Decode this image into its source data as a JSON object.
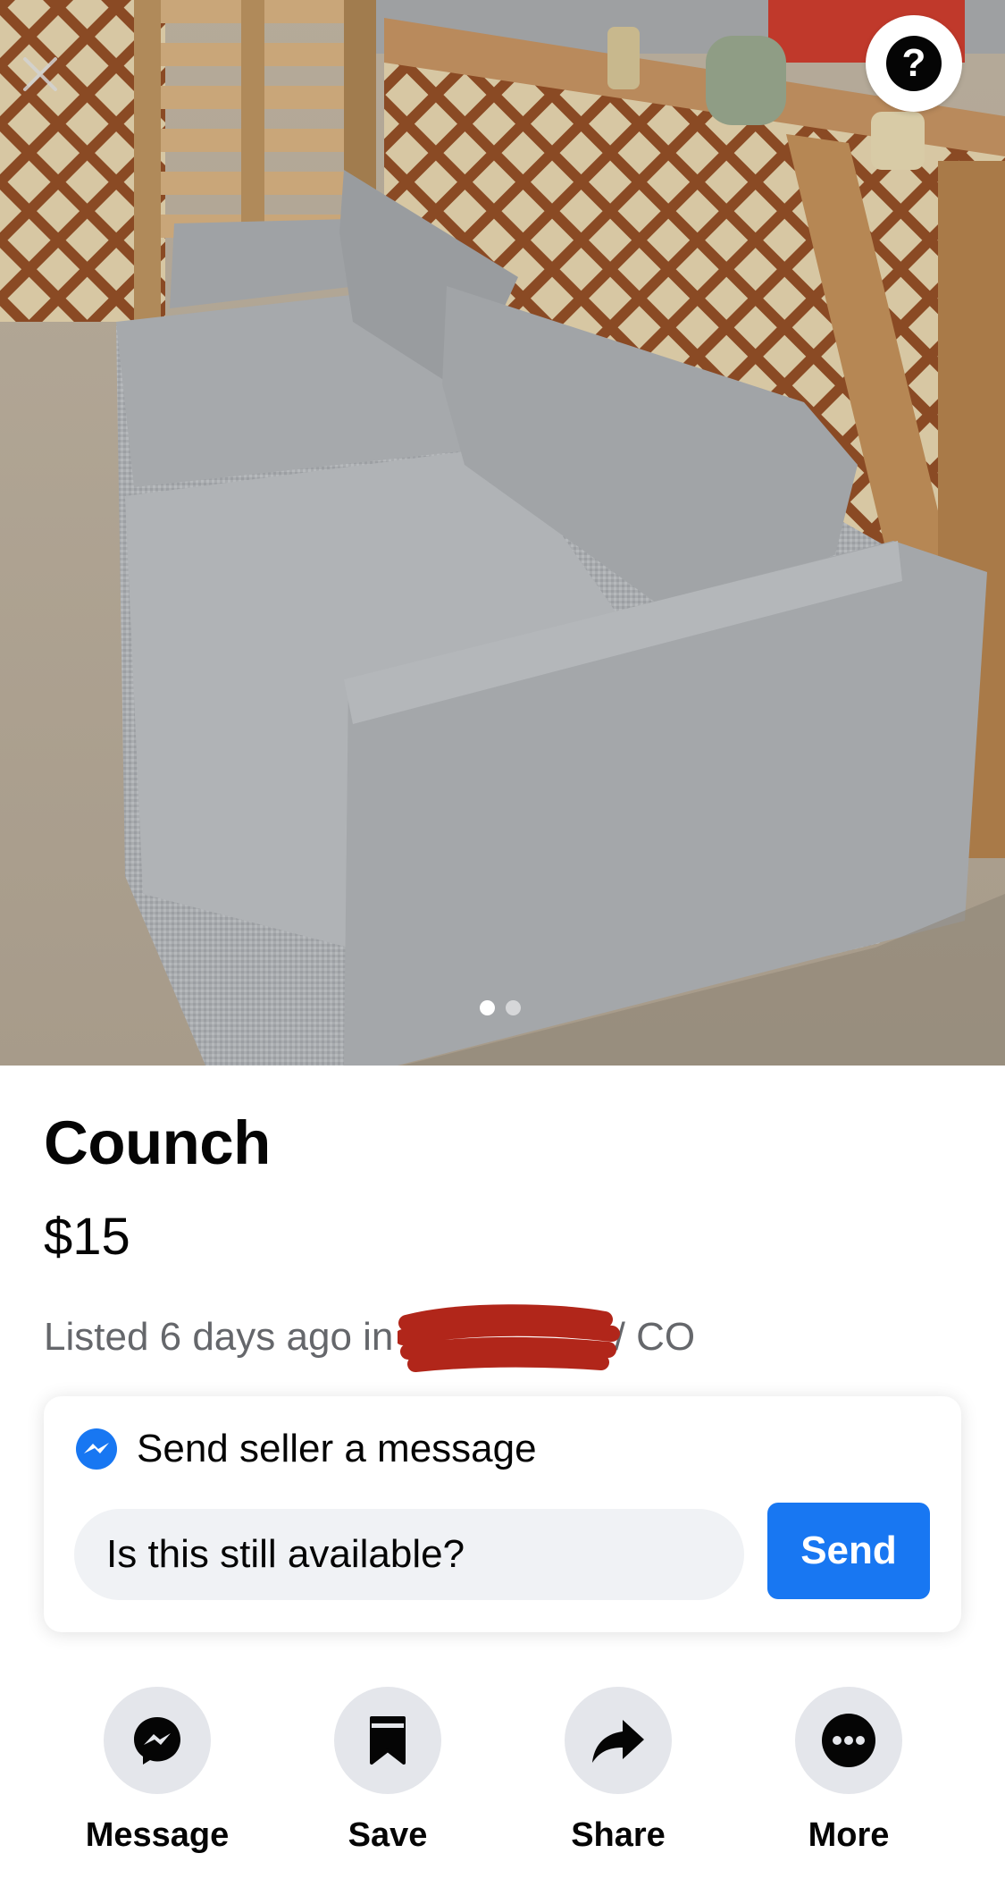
{
  "listing": {
    "title": "Counch",
    "price": "$15",
    "listed_prefix": "Listed 6 days ago in",
    "location_suffix": "/ CO"
  },
  "photo": {
    "image_count": 2,
    "active_index": 1,
    "close_icon": "close-icon",
    "help_icon": "question-mark-icon",
    "help_glyph": "?"
  },
  "message_card": {
    "title": "Send seller a message",
    "icon": "messenger-icon",
    "input_value": "Is this still available?",
    "send_label": "Send"
  },
  "actions": [
    {
      "label": "Message",
      "icon": "messenger-icon"
    },
    {
      "label": "Save",
      "icon": "bookmark-icon"
    },
    {
      "label": "Share",
      "icon": "share-arrow-icon"
    },
    {
      "label": "More",
      "icon": "more-dots-icon"
    }
  ],
  "colors": {
    "accent": "#1877f2",
    "secondary_text": "#65676b",
    "action_circle": "#e4e6eb",
    "input_bg": "#f0f2f5",
    "redaction": "#b1261a"
  }
}
